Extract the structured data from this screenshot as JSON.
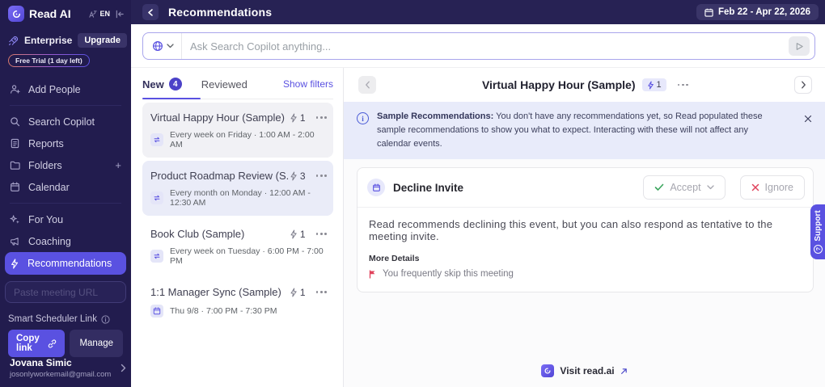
{
  "colors": {
    "accent": "#5A51E1",
    "sidebar_bg": "#221C4E",
    "topbar_bg": "#272254",
    "banner_bg": "#E8EBFA",
    "new_badge_bg": "#4C42C8",
    "success": "#3BA55D",
    "danger": "#E0435C"
  },
  "topbar": {
    "title": "Recommendations",
    "date_range": "Feb 22 - Apr 22, 2026"
  },
  "sidebar": {
    "brand": "Read AI",
    "language": "EN",
    "plan_label": "Enterprise",
    "upgrade_label": "Upgrade",
    "trial_label": "Free Trial (1 day left)",
    "nav": [
      {
        "label": "Add People"
      },
      {
        "label": "Search Copilot"
      },
      {
        "label": "Reports"
      },
      {
        "label": "Folders"
      },
      {
        "label": "Calendar"
      },
      {
        "label": "For You"
      },
      {
        "label": "Coaching"
      },
      {
        "label": "Recommendations"
      }
    ],
    "paste_placeholder": "Paste meeting URL",
    "scheduler_label": "Smart Scheduler Link",
    "copy_link_label": "Copy link",
    "manage_label": "Manage",
    "user": {
      "name": "Jovana Simic",
      "email": "josonlyworkemail@gmail.com"
    }
  },
  "search": {
    "placeholder": "Ask Search Copilot anything..."
  },
  "list": {
    "tabs": {
      "new_label": "New",
      "new_count": "4",
      "reviewed_label": "Reviewed",
      "filters_label": "Show filters"
    },
    "items": [
      {
        "title": "Virtual Happy Hour (Sample)",
        "count": "1",
        "schedule": "Every week on Friday · 1:00 AM - 2:00 AM"
      },
      {
        "title": "Product Roadmap Review (S...",
        "count": "3",
        "schedule": "Every month on Monday · 12:00 AM - 12:30 AM"
      },
      {
        "title": "Book Club (Sample)",
        "count": "1",
        "schedule": "Every week on Tuesday · 6:00 PM - 7:00 PM"
      },
      {
        "title": "1:1 Manager Sync (Sample)",
        "count": "1",
        "schedule": "Thu 9/8 · 7:00 PM - 7:30 PM"
      }
    ]
  },
  "detail": {
    "title": "Virtual Happy Hour (Sample)",
    "count": "1",
    "banner": {
      "lead": "Sample Recommendations:",
      "text": " You don't have any recommendations yet, so Read populated these sample recommendations to show you what to expect. Interacting with these will not affect any calendar events."
    },
    "card": {
      "title": "Decline Invite",
      "accept_label": "Accept",
      "ignore_label": "Ignore",
      "body": "Read recommends declining this event, but you can also respond as tentative to the meeting invite.",
      "more_details_label": "More Details",
      "reason": "You frequently skip this meeting"
    },
    "visit_label": "Visit read.ai"
  },
  "support": {
    "label": "Support"
  }
}
